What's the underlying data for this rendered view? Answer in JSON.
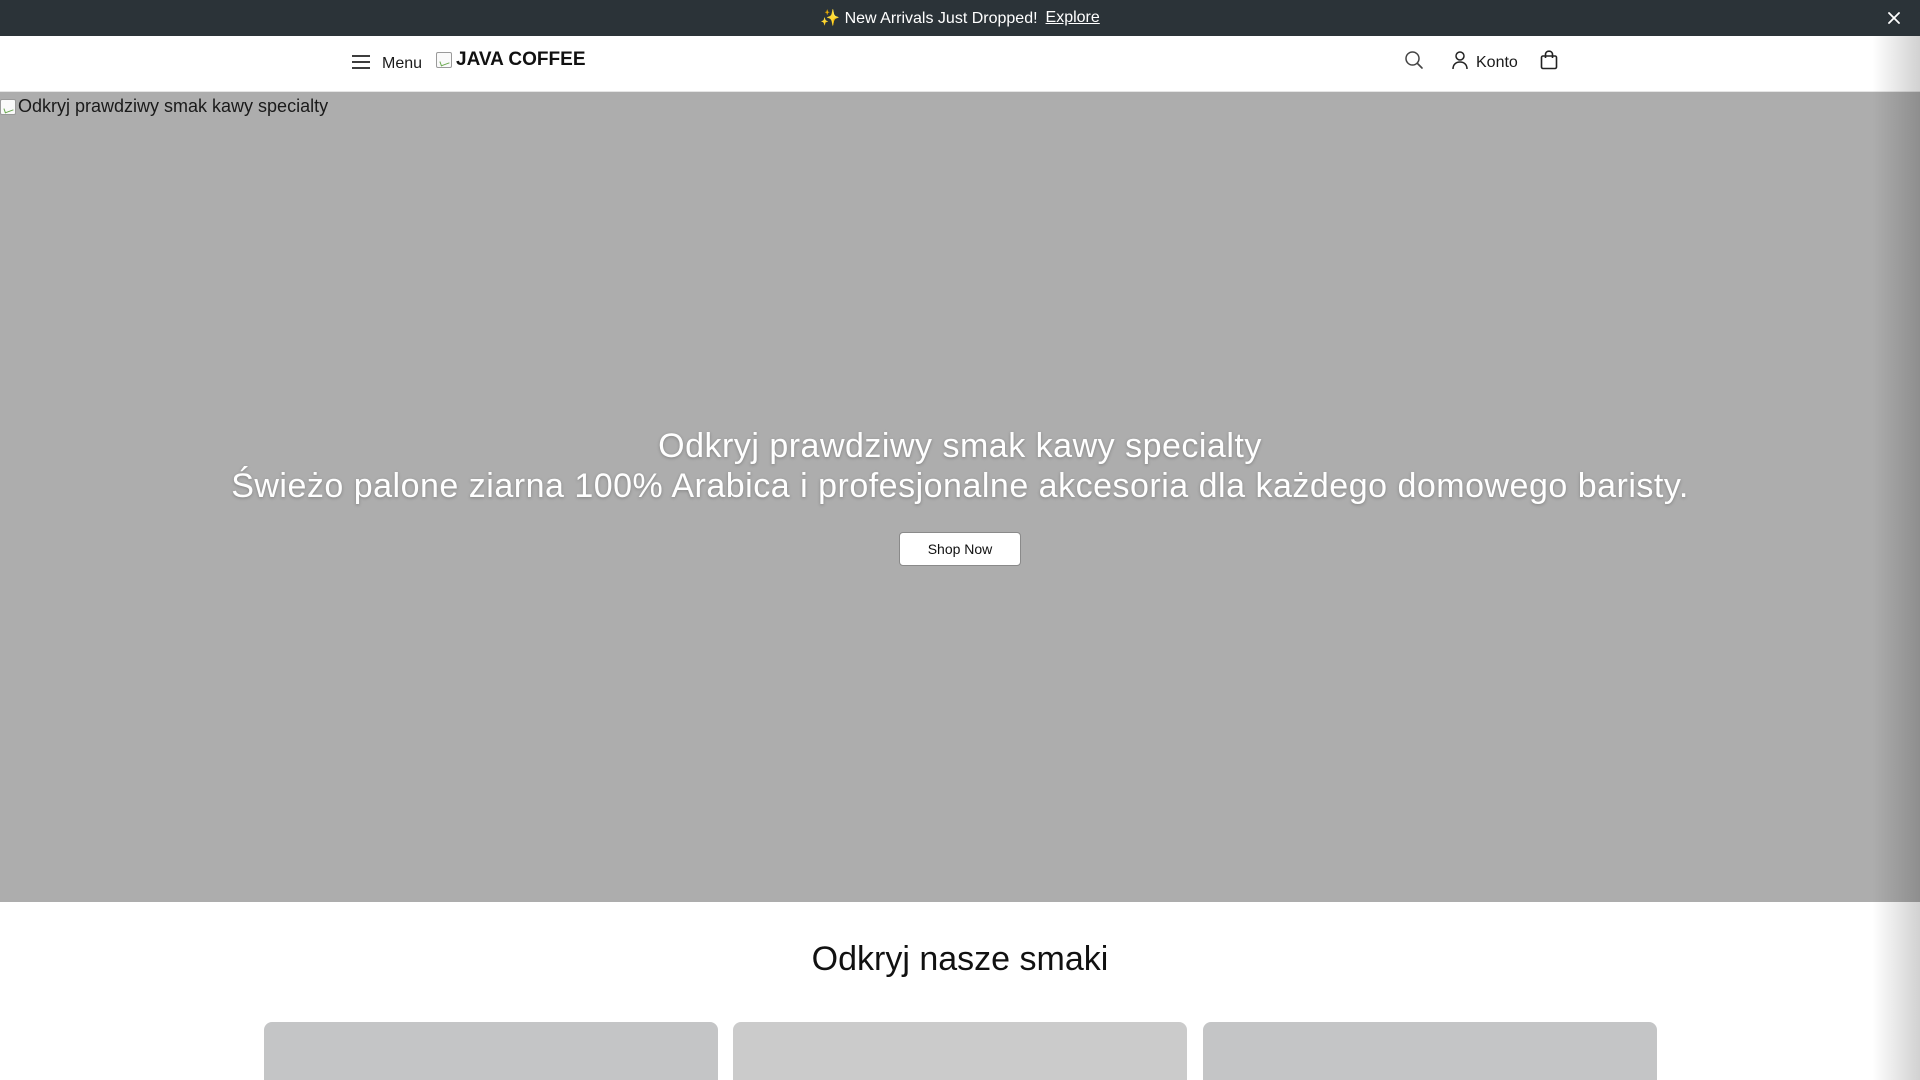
{
  "announcement": {
    "message": "✨ New Arrivals Just Dropped!",
    "link_label": "Explore",
    "close_icon": "close-icon"
  },
  "header": {
    "menu_label": "Menu",
    "logo_text": "JAVA COFFEE",
    "account_label": "Konto",
    "icons": [
      "hamburger-icon",
      "search-icon",
      "user-icon",
      "cart-bag-icon"
    ]
  },
  "hero": {
    "image_alt": "Odkryj prawdziwy smak kawy specialty",
    "title": "Odkryj prawdziwy smak kawy specialty",
    "subtitle": "Świeżo palone ziarna 100% Arabica i profesjonalne akcesoria dla każdego domowego baristy.",
    "cta_label": "Shop Now"
  },
  "section": {
    "title": "Odkryj nasze smaki"
  },
  "colors": {
    "announcement_bg": "#2b3338",
    "hero_bg": "#adadad",
    "card_bg": "#c4c5c6"
  }
}
